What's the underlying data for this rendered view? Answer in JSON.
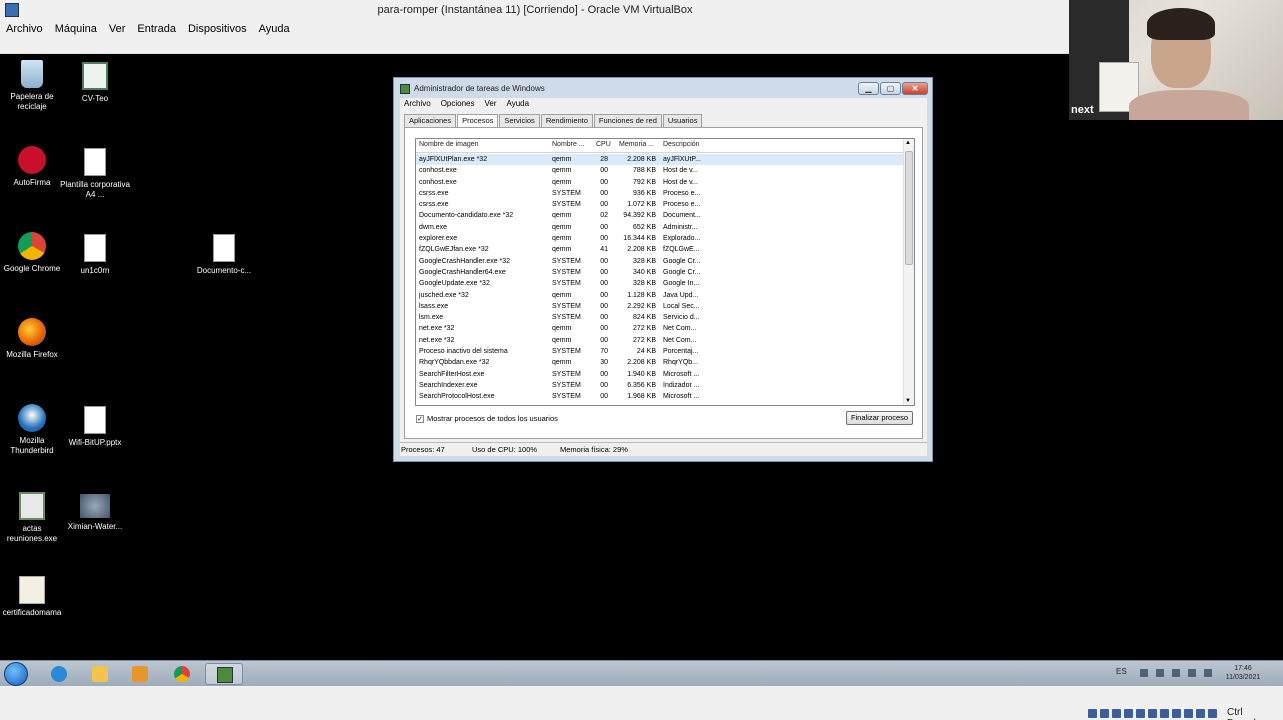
{
  "host": {
    "window_title": "para-romper (Instantánea 11) [Corriendo] - Oracle VM VirtualBox",
    "menu": [
      "Archivo",
      "Máquina",
      "Ver",
      "Entrada",
      "Dispositivos",
      "Ayuda"
    ],
    "host_key": "Ctrl Derecho"
  },
  "webcam": {
    "label": "next"
  },
  "desktop_icons": [
    {
      "label": "Papelera de reciclaje",
      "icon": "recycle-bin-icon"
    },
    {
      "label": "CV-Teo",
      "icon": "document-icon"
    },
    {
      "label": "AutoFirma",
      "icon": "autofirma-icon"
    },
    {
      "label": "Plantilla corporativa A4 ...",
      "icon": "docx-icon"
    },
    {
      "label": "Google Chrome",
      "icon": "chrome-icon"
    },
    {
      "label": "un1c0rn",
      "icon": "file-icon"
    },
    {
      "label": "Documento-c...",
      "icon": "file-icon"
    },
    {
      "label": "Mozilla Firefox",
      "icon": "firefox-icon"
    },
    {
      "label": "Mozilla Thunderbird",
      "icon": "thunderbird-icon"
    },
    {
      "label": "Wifi-BitUP.pptx",
      "icon": "file-icon"
    },
    {
      "label": "actas reuniones.exe",
      "icon": "exe-icon"
    },
    {
      "label": "Ximian-Water...",
      "icon": "image-icon"
    },
    {
      "label": "certificadomama",
      "icon": "certificate-icon"
    }
  ],
  "task_manager": {
    "title": "Administrador de tareas de Windows",
    "window_controls": [
      "minimize",
      "maximize",
      "close"
    ],
    "menu": [
      "Archivo",
      "Opciones",
      "Ver",
      "Ayuda"
    ],
    "tabs": [
      "Aplicaciones",
      "Procesos",
      "Servicios",
      "Rendimiento",
      "Funciones de red",
      "Usuarios"
    ],
    "active_tab": "Procesos",
    "columns": [
      "Nombre de imagen",
      "Nombre ...",
      "CPU",
      "Memoria ...",
      "Descripción"
    ],
    "processes": [
      {
        "name": "ayJFlXUtPlan.exe *32",
        "user": "qemm",
        "cpu": "28",
        "mem": "2.208 KB",
        "desc": "ayJFlXUtP...",
        "selected": true
      },
      {
        "name": "conhost.exe",
        "user": "qemm",
        "cpu": "00",
        "mem": "788 KB",
        "desc": "Host de v..."
      },
      {
        "name": "conhost.exe",
        "user": "qemm",
        "cpu": "00",
        "mem": "792 KB",
        "desc": "Host de v..."
      },
      {
        "name": "csrss.exe",
        "user": "SYSTEM",
        "cpu": "00",
        "mem": "936 KB",
        "desc": "Proceso e..."
      },
      {
        "name": "csrss.exe",
        "user": "SYSTEM",
        "cpu": "00",
        "mem": "1.072 KB",
        "desc": "Proceso e..."
      },
      {
        "name": "Documento-candidato.exe *32",
        "user": "qemm",
        "cpu": "02",
        "mem": "94.392 KB",
        "desc": "Document..."
      },
      {
        "name": "dwm.exe",
        "user": "qemm",
        "cpu": "00",
        "mem": "652 KB",
        "desc": "Administr..."
      },
      {
        "name": "explorer.exe",
        "user": "qemm",
        "cpu": "00",
        "mem": "16.344 KB",
        "desc": "Explorado..."
      },
      {
        "name": "fZQLGwEJfan.exe *32",
        "user": "qemm",
        "cpu": "41",
        "mem": "2.208 KB",
        "desc": "fZQLGwE..."
      },
      {
        "name": "GoogleCrashHandler.exe *32",
        "user": "SYSTEM",
        "cpu": "00",
        "mem": "328 KB",
        "desc": "Google Cr..."
      },
      {
        "name": "GoogleCrashHandler64.exe",
        "user": "SYSTEM",
        "cpu": "00",
        "mem": "340 KB",
        "desc": "Google Cr..."
      },
      {
        "name": "GoogleUpdate.exe *32",
        "user": "SYSTEM",
        "cpu": "00",
        "mem": "328 KB",
        "desc": "Google In..."
      },
      {
        "name": "jusched.exe *32",
        "user": "qemm",
        "cpu": "00",
        "mem": "1.128 KB",
        "desc": "Java Upd..."
      },
      {
        "name": "lsass.exe",
        "user": "SYSTEM",
        "cpu": "00",
        "mem": "2.292 KB",
        "desc": "Local Sec..."
      },
      {
        "name": "lsm.exe",
        "user": "SYSTEM",
        "cpu": "00",
        "mem": "824 KB",
        "desc": "Servicio d..."
      },
      {
        "name": "net.exe *32",
        "user": "qemm",
        "cpu": "00",
        "mem": "272 KB",
        "desc": "Net Com..."
      },
      {
        "name": "net.exe *32",
        "user": "qemm",
        "cpu": "00",
        "mem": "272 KB",
        "desc": "Net Com..."
      },
      {
        "name": "Proceso inactivo del sistema",
        "user": "SYSTEM",
        "cpu": "70",
        "mem": "24 KB",
        "desc": "Porcentaj..."
      },
      {
        "name": "RhqrYQbbdan.exe *32",
        "user": "qemm",
        "cpu": "30",
        "mem": "2.208 KB",
        "desc": "RhqrYQb..."
      },
      {
        "name": "SearchFilterHost.exe",
        "user": "SYSTEM",
        "cpu": "00",
        "mem": "1.940 KB",
        "desc": "Microsoft ..."
      },
      {
        "name": "SearchIndexer.exe",
        "user": "SYSTEM",
        "cpu": "00",
        "mem": "6.356 KB",
        "desc": "Indizador ..."
      },
      {
        "name": "SearchProtocolHost.exe",
        "user": "SYSTEM",
        "cpu": "00",
        "mem": "1.968 KB",
        "desc": "Microsoft ..."
      }
    ],
    "show_all_label": "Mostrar procesos de todos los usuarios",
    "show_all_checked": true,
    "end_process_label": "Finalizar proceso",
    "status": {
      "processes": "Procesos: 47",
      "cpu": "Uso de CPU: 100%",
      "memory": "Memoria física: 29%"
    }
  },
  "taskbar": {
    "pinned": [
      "windows-start-icon",
      "internet-explorer-icon",
      "explorer-folder-icon",
      "media-player-icon",
      "chrome-icon",
      "task-manager-icon"
    ],
    "language": "ES",
    "time": "17:46",
    "date": "11/03/2021"
  }
}
